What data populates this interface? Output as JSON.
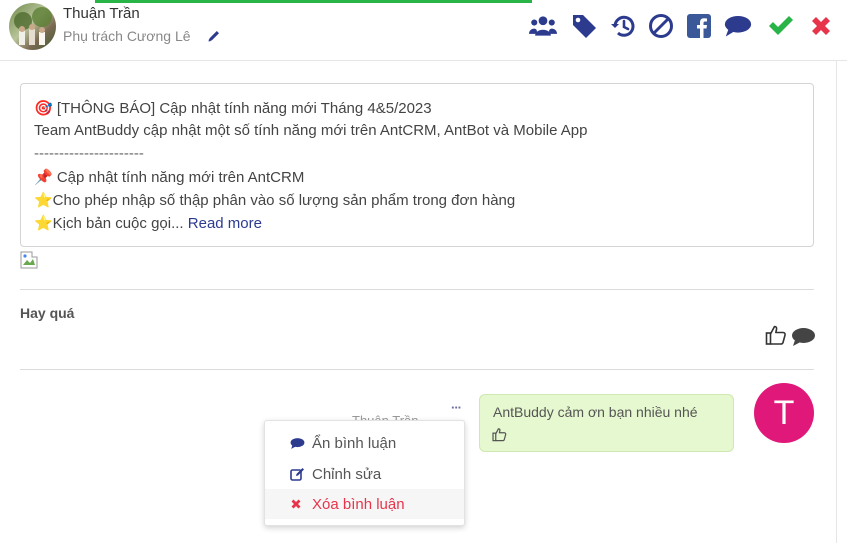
{
  "header": {
    "user_name": "Thuận Trần",
    "assignee_text": "Phụ trách Cương Lê",
    "toolbar_icons": [
      "users-icon",
      "tag-icon",
      "history-icon",
      "ban-icon",
      "facebook-icon",
      "comment-icon",
      "check-icon",
      "close-icon"
    ]
  },
  "post": {
    "title": "🎯 [THÔNG BÁO] Cập nhật tính năng mới Tháng 4&5/2023",
    "line2": "Team AntBuddy cập nhật một số tính năng mới trên AntCRM, AntBot và Mobile App",
    "separator": "----------------------",
    "line4": "📌 Cập nhật tính năng mới trên AntCRM",
    "line5": "⭐Cho phép nhập số thập phân vào số lượng sản phẩm trong đơn hàng",
    "line6": "⭐Kịch bản cuộc gọi...",
    "read_more": "Read more"
  },
  "comment": {
    "text": "Hay quá"
  },
  "reply": {
    "author": "Thuận Trần",
    "dots": "···",
    "text": "AntBuddy cảm ơn bạn nhiều nhé",
    "avatar_letter": "T"
  },
  "context_menu": {
    "hide_label": "Ẩn bình luận",
    "edit_label": "Chỉnh sửa",
    "delete_label": "Xóa bình luận"
  },
  "colors": {
    "icon_blue": "#2d3b8f",
    "facebook": "#3b5998",
    "check": "#28b446",
    "close": "#e8344a",
    "avatar": "#e0187a",
    "bubble": "#e6f8cf"
  }
}
